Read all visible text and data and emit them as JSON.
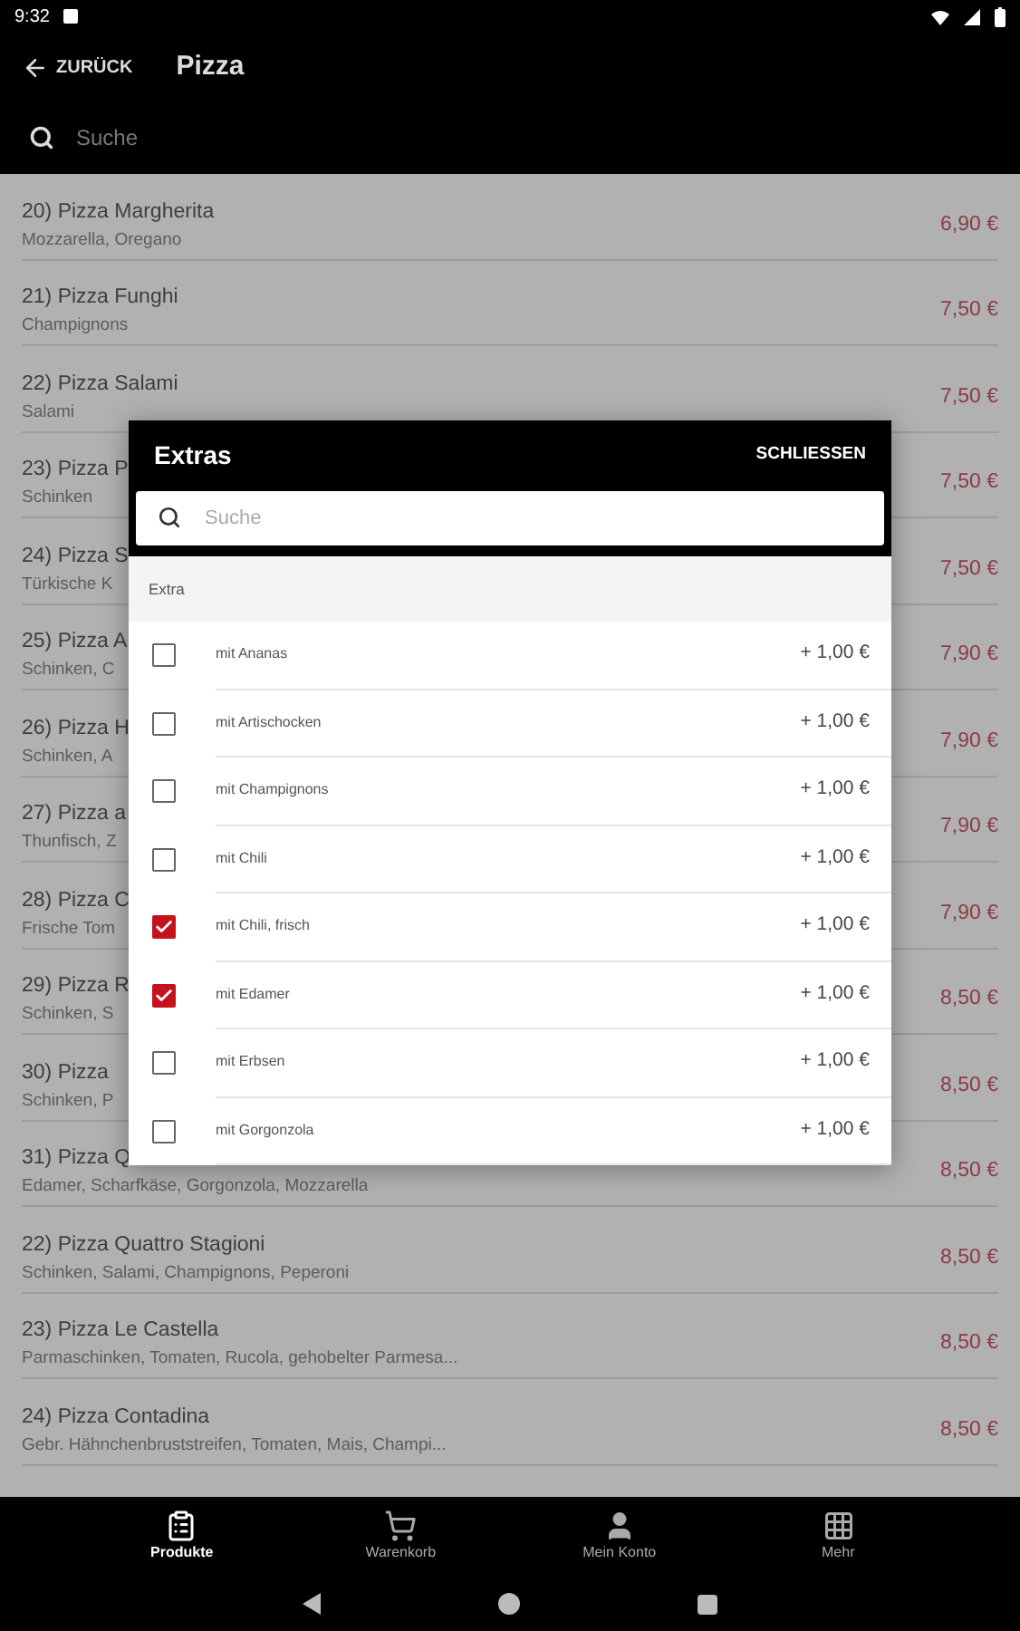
{
  "status_bar": {
    "time": "9:32"
  },
  "app_bar": {
    "back_label": "ZURÜCK",
    "title": "Pizza"
  },
  "search": {
    "placeholder": "Suche"
  },
  "products": [
    {
      "name": "20) Pizza Margherita",
      "description": "Mozzarella, Oregano",
      "price": "6,90 €"
    },
    {
      "name": "21) Pizza Funghi",
      "description": "Champignons",
      "price": "7,50 €"
    },
    {
      "name": "22) Pizza Salami",
      "description": "Salami",
      "price": "7,50 €"
    },
    {
      "name": "23) Pizza P",
      "description": "Schinken",
      "price": "7,50 €"
    },
    {
      "name": "24) Pizza S",
      "description": "Türkische K",
      "price": "7,50 €"
    },
    {
      "name": "25) Pizza A",
      "description": "Schinken, C",
      "price": "7,90 €"
    },
    {
      "name": "26) Pizza H",
      "description": "Schinken, A",
      "price": "7,90 €"
    },
    {
      "name": "27) Pizza a",
      "description": "Thunfisch, Z",
      "price": "7,90 €"
    },
    {
      "name": "28) Pizza C",
      "description": "Frische Tom",
      "price": "7,90 €"
    },
    {
      "name": "29) Pizza R",
      "description": "Schinken, S",
      "price": "8,50 €"
    },
    {
      "name": "30) Pizza",
      "description": "Schinken, P",
      "price": "8,50 €"
    },
    {
      "name": "31) Pizza Q",
      "description": "Edamer, Scharfkäse, Gorgonzola, Mozzarella",
      "price": "8,50 €"
    },
    {
      "name": "22) Pizza Quattro Stagioni",
      "description": "Schinken, Salami, Champignons, Peperoni",
      "price": "8,50 €"
    },
    {
      "name": "23) Pizza Le Castella",
      "description": "Parmaschinken, Tomaten, Rucola, gehobelter Parmesa...",
      "price": "8,50 €"
    },
    {
      "name": "24) Pizza Contadina",
      "description": "Gebr. Hähnchenbruststreifen, Tomaten, Mais, Champi...",
      "price": "8,50 €"
    }
  ],
  "dialog": {
    "title": "Extras",
    "close_label": "SCHLIESSEN",
    "search": {
      "placeholder": "Suche"
    },
    "section": "Extra",
    "items": [
      {
        "label": "mit Ananas",
        "price": "+ 1,00 €",
        "checked": false
      },
      {
        "label": "mit Artischocken",
        "price": "+ 1,00 €",
        "checked": false
      },
      {
        "label": "mit Champignons",
        "price": "+ 1,00 €",
        "checked": false
      },
      {
        "label": "mit Chili",
        "price": "+ 1,00 €",
        "checked": false
      },
      {
        "label": "mit Chili, frisch",
        "price": "+ 1,00 €",
        "checked": true
      },
      {
        "label": "mit Edamer",
        "price": "+ 1,00 €",
        "checked": true
      },
      {
        "label": "mit Erbsen",
        "price": "+ 1,00 €",
        "checked": false
      },
      {
        "label": "mit Gorgonzola",
        "price": "+ 1,00 €",
        "checked": false
      }
    ]
  },
  "bottom_nav": [
    {
      "kind": "products",
      "label": "Produkte",
      "selected": true
    },
    {
      "kind": "cart",
      "label": "Warenkorb",
      "selected": false
    },
    {
      "kind": "account",
      "label": "Mein Konto",
      "selected": false
    },
    {
      "kind": "more",
      "label": "Mehr",
      "selected": false
    }
  ]
}
